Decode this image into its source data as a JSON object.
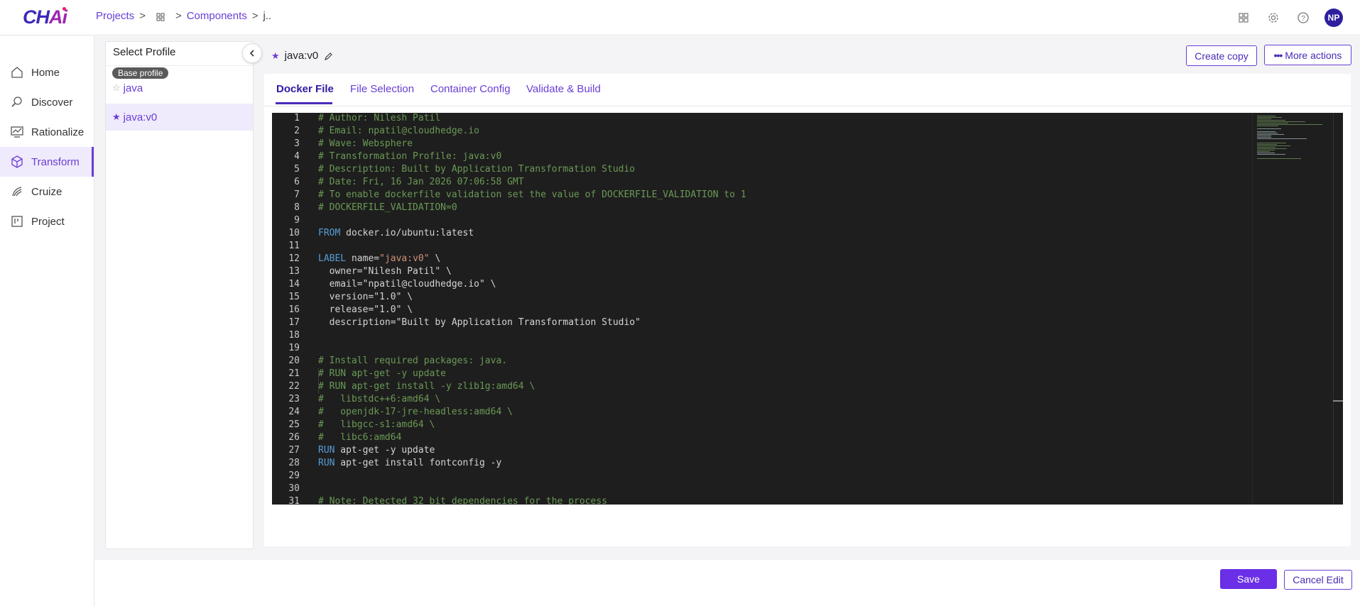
{
  "app": {
    "logo": "CHAi"
  },
  "breadcrumb": {
    "projects": "Projects",
    "components": "Components",
    "current": "j.."
  },
  "user": {
    "initials": "NP"
  },
  "sidebar": {
    "items": [
      {
        "label": "Home",
        "icon": "home-icon"
      },
      {
        "label": "Discover",
        "icon": "discover-icon"
      },
      {
        "label": "Rationalize",
        "icon": "rationalize-icon"
      },
      {
        "label": "Transform",
        "icon": "transform-icon",
        "active": true
      },
      {
        "label": "Cruize",
        "icon": "cruize-icon"
      },
      {
        "label": "Project",
        "icon": "project-icon"
      }
    ]
  },
  "profiles": {
    "header": "Select Profile",
    "base_badge": "Base profile",
    "items": [
      {
        "label": "java",
        "starred": false
      },
      {
        "label": "java:v0",
        "starred": true,
        "selected": true
      }
    ]
  },
  "content": {
    "title": "java:v0",
    "create_copy": "Create copy",
    "more_actions": "More actions",
    "tabs": [
      "Docker File",
      "File Selection",
      "Container Config",
      "Validate & Build"
    ]
  },
  "editor": {
    "lines": [
      "# Author: Nilesh Patil",
      "# Email: npatil@cloudhedge.io",
      "# Wave: Websphere",
      "# Transformation Profile: java:v0",
      "# Description: Built by Application Transformation Studio",
      "# Date: Fri, 16 Jan 2026 07:06:58 GMT",
      "# To enable dockerfile validation set the value of DOCKERFILE_VALIDATION to 1",
      "# DOCKERFILE_VALIDATION=0",
      "",
      "FROM docker.io/ubuntu:latest",
      "",
      "LABEL name=\"java:v0\" \\",
      "  owner=\"Nilesh Patil\" \\",
      "  email=\"npatil@cloudhedge.io\" \\",
      "  version=\"1.0\" \\",
      "  release=\"1.0\" \\",
      "  description=\"Built by Application Transformation Studio\"",
      "",
      "",
      "# Install required packages: java.",
      "# RUN apt-get -y update",
      "# RUN apt-get install -y zlib1g:amd64 \\",
      "#   libstdc++6:amd64 \\",
      "#   openjdk-17-jre-headless:amd64 \\",
      "#   libgcc-s1:amd64 \\",
      "#   libc6:amd64",
      "RUN apt-get -y update",
      "RUN apt-get install fontconfig -y",
      "",
      "",
      "# Note: Detected 32 bit dependencies for the process"
    ]
  },
  "footer": {
    "save": "Save",
    "cancel": "Cancel Edit"
  }
}
